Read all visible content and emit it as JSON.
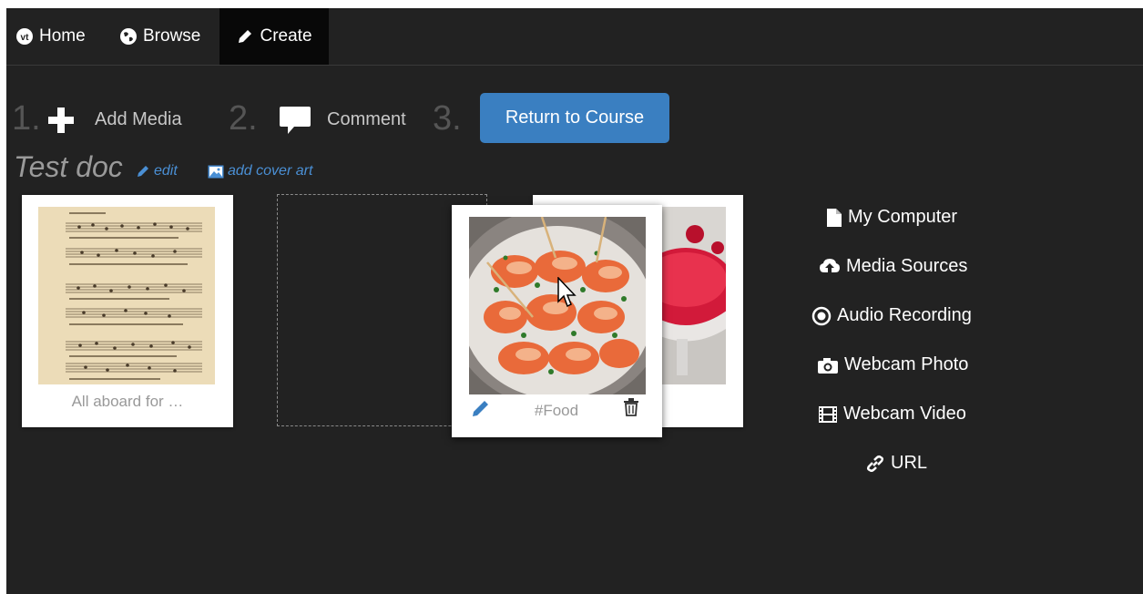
{
  "nav": {
    "items": [
      {
        "label": "Home",
        "icon": "vt-logo-icon",
        "active": false
      },
      {
        "label": "Browse",
        "icon": "globe-icon",
        "active": false
      },
      {
        "label": "Create",
        "icon": "pencil-icon",
        "active": true
      }
    ]
  },
  "steps": {
    "step1_number": "1.",
    "step1_label": "Add Media",
    "step2_number": "2.",
    "step2_label": "Comment",
    "step3_number": "3.",
    "return_button": "Return to Course"
  },
  "doc": {
    "title": "Test doc",
    "edit_label": "edit",
    "cover_label": "add cover art"
  },
  "cards": [
    {
      "caption": "All aboard for …",
      "image": "sheet-music"
    },
    {
      "caption": "#Food",
      "image": "shrimp-dish"
    },
    {
      "caption": "",
      "image": "raspberry-sorbet"
    }
  ],
  "media_sources": [
    {
      "label": "My Computer",
      "icon": "file-icon"
    },
    {
      "label": "Media Sources",
      "icon": "cloud-upload-icon"
    },
    {
      "label": "Audio Recording",
      "icon": "record-icon"
    },
    {
      "label": "Webcam Photo",
      "icon": "camera-icon"
    },
    {
      "label": "Webcam Video",
      "icon": "film-icon"
    },
    {
      "label": "URL",
      "icon": "link-icon"
    }
  ],
  "colors": {
    "background": "#222222",
    "nav_active": "#080808",
    "accent_button": "#3a7fc1",
    "link": "#4a8fd4",
    "step_number": "#555555"
  }
}
